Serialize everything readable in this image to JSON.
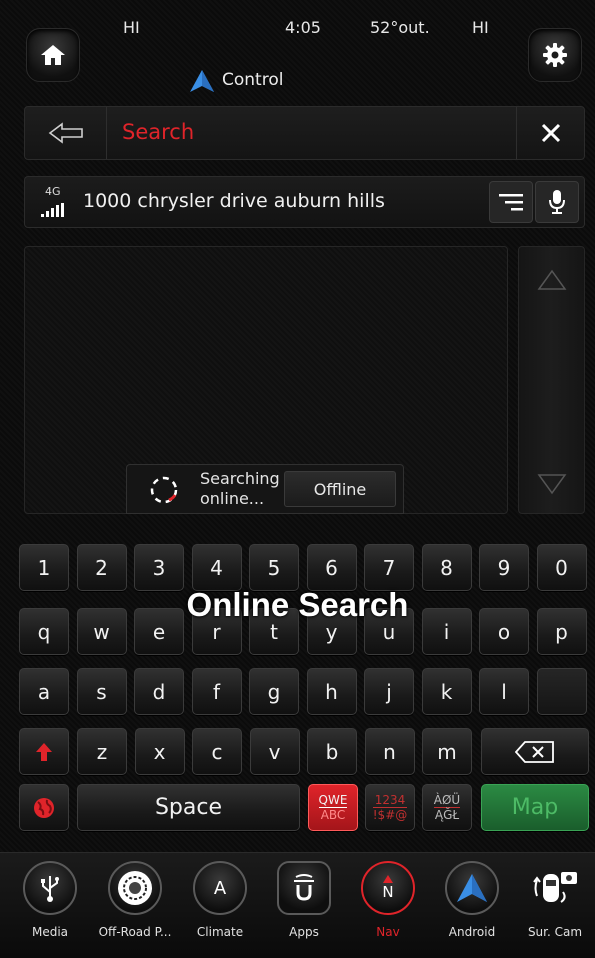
{
  "status": {
    "left_temp": "HI",
    "time": "4:05",
    "outside_temp": "52°out.",
    "right_temp": "HI"
  },
  "header": {
    "title": "Control"
  },
  "search": {
    "label": "Search"
  },
  "query": {
    "network": "4G",
    "text": "1000 chrysler drive auburn hills"
  },
  "results": {
    "status_line1": "Searching",
    "status_line2": "online...",
    "offline_button": "Offline"
  },
  "overlay": {
    "caption": "Online Search"
  },
  "keyboard": {
    "row1": [
      "1",
      "2",
      "3",
      "4",
      "5",
      "6",
      "7",
      "8",
      "9",
      "0"
    ],
    "row2": [
      "q",
      "w",
      "e",
      "r",
      "t",
      "y",
      "u",
      "i",
      "o",
      "p"
    ],
    "row3": [
      "a",
      "s",
      "d",
      "f",
      "g",
      "h",
      "j",
      "k",
      "l",
      ""
    ],
    "row4": [
      "z",
      "x",
      "c",
      "v",
      "b",
      "n",
      "m"
    ],
    "space": "Space",
    "mode_qwe_top": "QWE",
    "mode_qwe_bottom": "ABC",
    "mode_num_top": "1234",
    "mode_num_bottom": "!$#@",
    "mode_intl_top": "ÀØÜ",
    "mode_intl_bottom": "ĄĞŁ",
    "map": "Map"
  },
  "dock": [
    {
      "label": "Media",
      "icon": "usb-icon"
    },
    {
      "label": "Off-Road P...",
      "icon": "tire-icon"
    },
    {
      "label": "Climate",
      "icon": "climate-icon",
      "glyph": "A"
    },
    {
      "label": "Apps",
      "icon": "apps-icon"
    },
    {
      "label": "Nav",
      "icon": "compass-icon",
      "glyph": "N"
    },
    {
      "label": "Android",
      "icon": "android-auto-icon"
    },
    {
      "label": "Sur. Cam",
      "icon": "surround-camera-icon"
    }
  ],
  "colors": {
    "accent_red": "#e0242a",
    "map_green": "#1f6b32",
    "nav_blue": "#3a8fe6"
  }
}
